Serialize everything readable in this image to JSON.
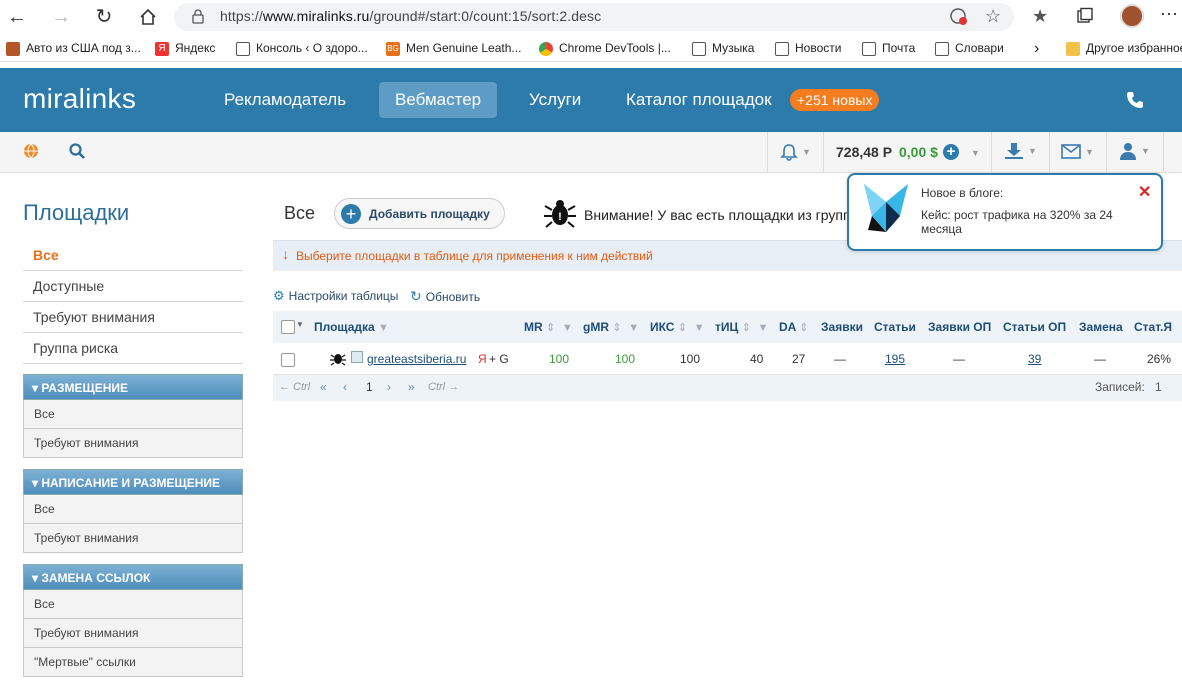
{
  "browser": {
    "url_prefix": "https://",
    "url_host": "www.miralinks.ru",
    "url_path": "/ground#/start:0/count:15/sort:2.desc",
    "bookmarks": [
      {
        "label": "Авто из США под з...",
        "color": "#b3562a"
      },
      {
        "label": "Яндекс",
        "color": "#e33"
      },
      {
        "label": "Консоль ‹ О здоро...",
        "color": "#555"
      },
      {
        "label": "Men Genuine Leath...",
        "color": "#e8701a"
      },
      {
        "label": "Chrome DevTools |...",
        "color": "#4285f4"
      },
      {
        "label": "Музыка",
        "color": "#555"
      },
      {
        "label": "Новости",
        "color": "#555"
      },
      {
        "label": "Почта",
        "color": "#555"
      },
      {
        "label": "Словари",
        "color": "#555"
      }
    ],
    "other_bookmarks": "Другое избранное"
  },
  "header": {
    "logo": "miralinks",
    "nav": [
      "Рекламодатель",
      "Вебмастер",
      "Услуги",
      "Каталог площадок"
    ],
    "new_badge": "+251 новых"
  },
  "subheader": {
    "balance_rub": "728,48 Р",
    "balance_usd": "0,00 $"
  },
  "sidebar": {
    "title": "Площадки",
    "items": [
      "Все",
      "Доступные",
      "Требуют внимания",
      "Группа риска"
    ],
    "panels": [
      {
        "title": "Размещение",
        "items": [
          "Все",
          "Требуют внимания"
        ]
      },
      {
        "title": "Написание и размещение",
        "items": [
          "Все",
          "Требуют внимания"
        ]
      },
      {
        "title": "Замена ссылок",
        "items": [
          "Все",
          "Требуют внимания",
          "\"Мертвые\" ссылки"
        ]
      }
    ]
  },
  "main": {
    "title": "Все",
    "add_button": "Добавить площадку",
    "warning": "Внимание! У вас есть площадки из группы риска",
    "hint": "Выберите площадки в таблице для применения к ним действий",
    "table_settings": "Настройки таблицы",
    "refresh": "Обновить",
    "columns": [
      "Площадка",
      "MR",
      "gMR",
      "ИКС",
      "тИЦ",
      "DA",
      "Заявки",
      "Статьи",
      "Заявки ОП",
      "Статьи ОП",
      "Замена",
      "Стат.Я"
    ],
    "row": {
      "site": "greateastsiberia.ru",
      "engines_y": "Я",
      "engines_rest": "+ G",
      "mr": "100",
      "gmr": "100",
      "iks": "100",
      "tic": "40",
      "da": "27",
      "orders": "—",
      "articles": "195",
      "orders_op": "—",
      "articles_op": "39",
      "replace": "—",
      "stat_y": "26%"
    },
    "pager": {
      "prev_ctrl": "← Ctrl",
      "next_ctrl": "Ctrl →",
      "page": "1",
      "records_label": "Записей:",
      "records": "1"
    }
  },
  "popup": {
    "title": "Новое в блоге:",
    "text": "Кейс: рост трафика на 320% за 24 месяца"
  }
}
